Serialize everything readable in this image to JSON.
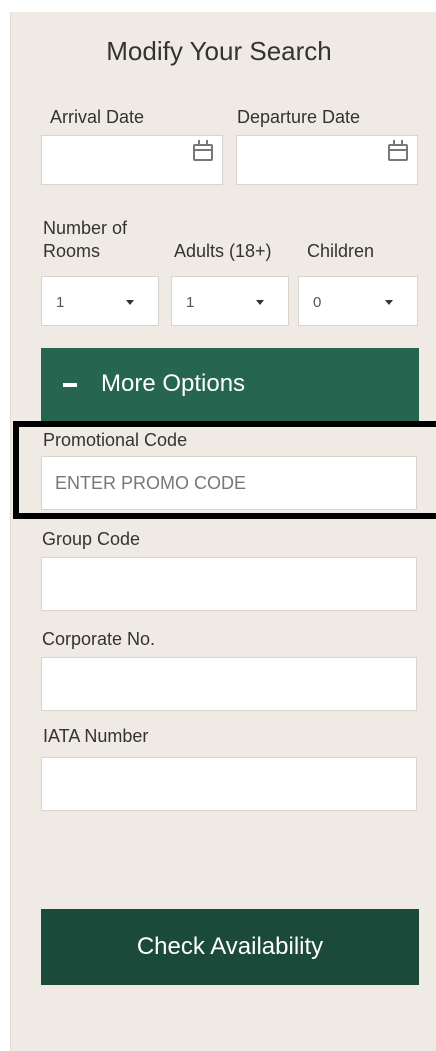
{
  "panel": {
    "title": "Modify Your Search"
  },
  "dates": {
    "arrival_label": "Arrival Date",
    "departure_label": "Departure Date",
    "calendar_icon": "calendar-icon"
  },
  "occupancy": {
    "rooms_label_line1": "Number of",
    "rooms_label_line2": "Rooms",
    "adults_label": "Adults (18+)",
    "children_label": "Children",
    "rooms_value": "1",
    "adults_value": "1",
    "children_value": "0"
  },
  "more_options": {
    "icon": "minus-icon",
    "label": "More Options"
  },
  "promo": {
    "label": "Promotional Code",
    "placeholder": "ENTER PROMO CODE"
  },
  "group": {
    "label": "Group Code"
  },
  "corporate": {
    "label": "Corporate No."
  },
  "iata": {
    "label": "IATA Number"
  },
  "submit": {
    "label": "Check Availability"
  },
  "colors": {
    "panel_bg": "#efebe4",
    "more_options_bg": "#266650",
    "submit_bg": "#1b4a3b",
    "highlight_border": "#000000"
  }
}
